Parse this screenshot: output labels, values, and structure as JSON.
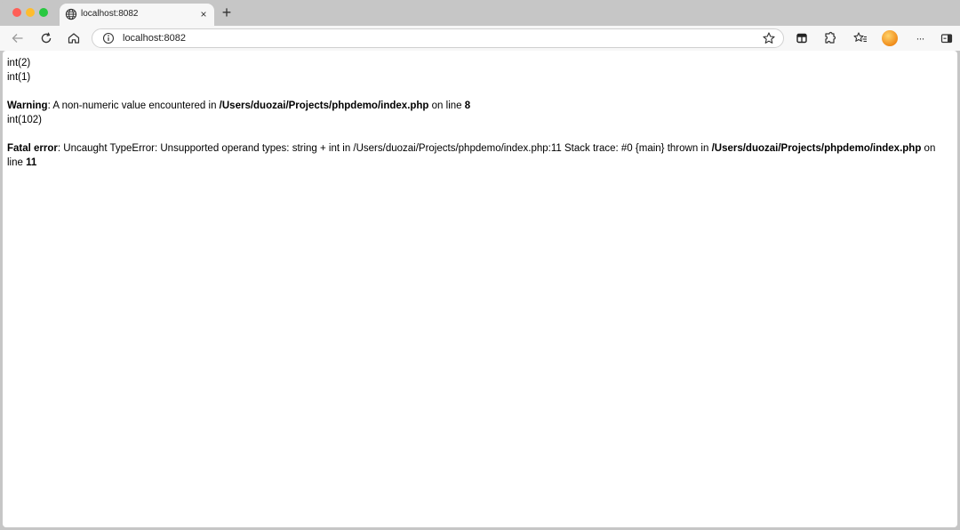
{
  "tab": {
    "title": "localhost:8082",
    "close_glyph": "×",
    "new_tab_glyph": "+"
  },
  "address": {
    "url": "localhost:8082"
  },
  "icons": {
    "back": "back-arrow-icon",
    "reload": "reload-icon",
    "home": "home-icon",
    "info": "info-icon",
    "star": "star-icon",
    "collections": "collections-icon",
    "extensions": "extensions-icon",
    "favorites": "favorites-icon",
    "more": "more-icon",
    "sidebar": "sidebar-icon"
  },
  "toolbar": {
    "more_glyph": "···"
  },
  "output": {
    "line1": "int(2)",
    "line2": "int(1)",
    "warning": {
      "label": "Warning",
      "sep": ": ",
      "text": "A non-numeric value encountered in ",
      "path": "/Users/duozai/Projects/phpdemo/index.php",
      "on_line": " on line ",
      "line_no": "8"
    },
    "line3": "int(102)",
    "fatal": {
      "label": "Fatal error",
      "sep": ": ",
      "text": "Uncaught TypeError: Unsupported operand types: string + int in /Users/duozai/Projects/phpdemo/index.php:11 Stack trace: #0 {main} thrown in ",
      "path": "/Users/duozai/Projects/phpdemo/index.php",
      "on_line": " on line ",
      "line_no": "11"
    }
  },
  "colors": {
    "chrome_bg": "#c6c6c6",
    "toolbar_bg": "#f7f7f7",
    "traffic_red": "#ff5f57",
    "traffic_yellow": "#febc2e",
    "traffic_green": "#28c840"
  }
}
